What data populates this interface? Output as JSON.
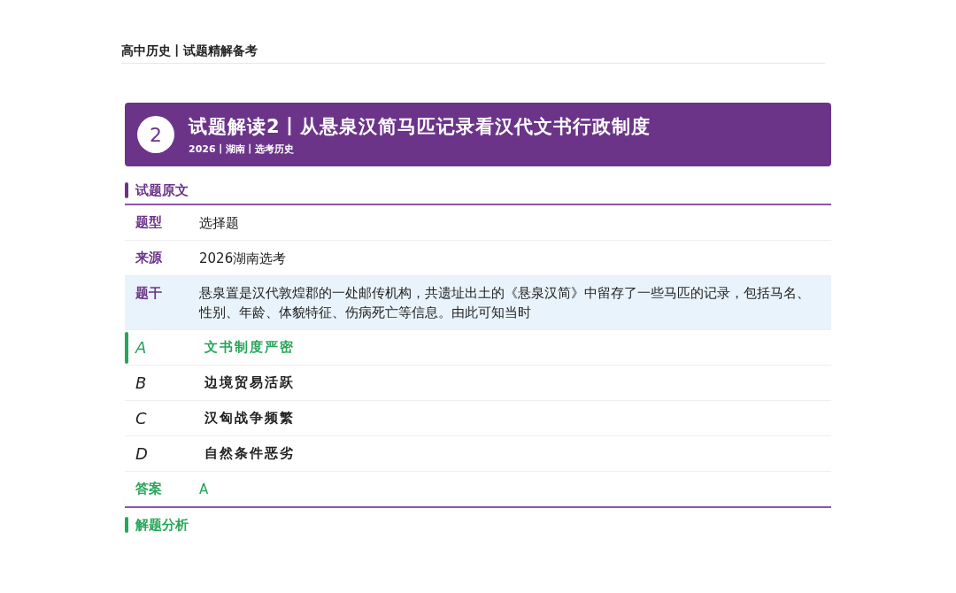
{
  "page_header": {
    "title": "高中历史丨试题精解备考"
  },
  "banner": {
    "number": "2",
    "title": "试题解读2丨从悬泉汉简马匹记录看汉代文书行政制度",
    "subtitle": "2026丨湖南丨选考历史"
  },
  "section": {
    "title": "试题原文"
  },
  "fields": [
    {
      "label": "题型",
      "value": "选择题",
      "highlighted": false
    },
    {
      "label": "来源",
      "value": "2026湖南选考",
      "highlighted": false
    },
    {
      "label": "题干",
      "value": "悬泉置是汉代敦煌郡的一处邮传机构，共遗址出土的《悬泉汉简》中留存了一些马匹的记录，包括马名、性别、年龄、体貌特征、伤病死亡等信息。由此可知当时",
      "highlighted": true
    }
  ],
  "options": [
    {
      "letter": "A",
      "text": "文书制度严密",
      "selected": true
    },
    {
      "letter": "B",
      "text": "边境贸易活跃",
      "selected": false
    },
    {
      "letter": "C",
      "text": "汉匈战争频繁",
      "selected": false
    },
    {
      "letter": "D",
      "text": "自然条件恶劣",
      "selected": false
    }
  ],
  "answer": {
    "label": "答案",
    "value": "A"
  },
  "next_section": {
    "title": "解题分析"
  }
}
